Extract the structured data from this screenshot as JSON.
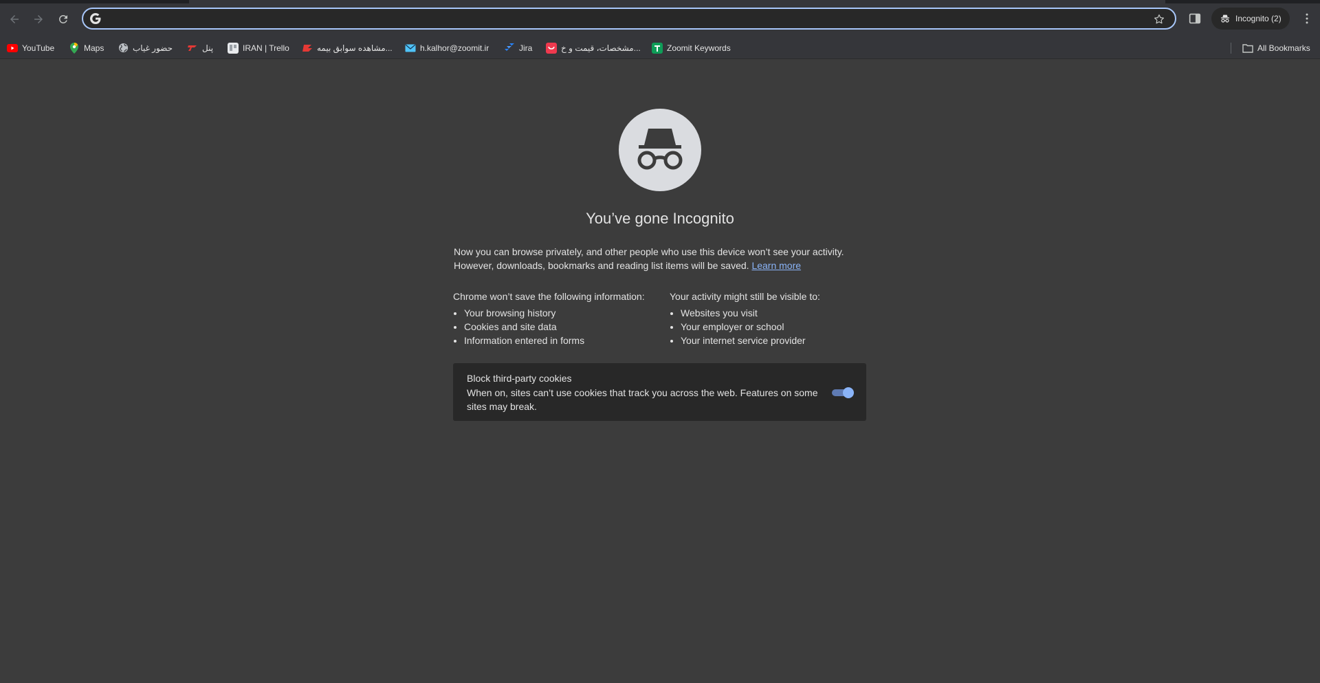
{
  "browser": {
    "incognito_label": "Incognito (2)",
    "omnibox_value": "",
    "all_bookmarks_label": "All Bookmarks"
  },
  "bookmarks": [
    {
      "label": "YouTube",
      "icon": "youtube-icon",
      "color": "#ff0000"
    },
    {
      "label": "Maps",
      "icon": "maps-icon",
      "color": "#34a853"
    },
    {
      "label": "حضور غیاب",
      "icon": "globe-icon",
      "color": "#bdc1c6"
    },
    {
      "label": "پنل",
      "icon": "panel-icon",
      "color": "#e53935"
    },
    {
      "label": "IRAN | Trello",
      "icon": "trello-icon",
      "color": "#e8eaed"
    },
    {
      "label": "مشاهده سوابق بیمه...",
      "icon": "insurance-icon",
      "color": "#e53935"
    },
    {
      "label": "h.kalhor@zoomit.ir",
      "icon": "mail-icon",
      "color": "#4fc3f7"
    },
    {
      "label": "Jira",
      "icon": "jira-icon",
      "color": "#2684ff"
    },
    {
      "label": "مشخصات، قیمت و خ...",
      "icon": "digikala-icon",
      "color": "#ef394e"
    },
    {
      "label": "Zoomit Keywords",
      "icon": "sheets-icon",
      "color": "#0f9d58"
    }
  ],
  "page": {
    "title": "You’ve gone Incognito",
    "intro_line1": "Now you can browse privately, and other people who use this device won’t see your activity.",
    "intro_line2": "However, downloads, bookmarks and reading list items will be saved.",
    "learn_more": "Learn more",
    "left_column": {
      "heading": "Chrome won’t save the following information:",
      "items": [
        "Your browsing history",
        "Cookies and site data",
        "Information entered in forms"
      ]
    },
    "right_column": {
      "heading": "Your activity might still be visible to:",
      "items": [
        "Websites you visit",
        "Your employer or school",
        "Your internet service provider"
      ]
    },
    "cookie_card": {
      "title": "Block third-party cookies",
      "description": "When on, sites can’t use cookies that track you across the web. Features on some sites may break.",
      "toggle_on": true
    }
  },
  "colors": {
    "accent": "#8ab4f8",
    "page_bg": "#3c3c3c",
    "card_bg": "#282828"
  }
}
